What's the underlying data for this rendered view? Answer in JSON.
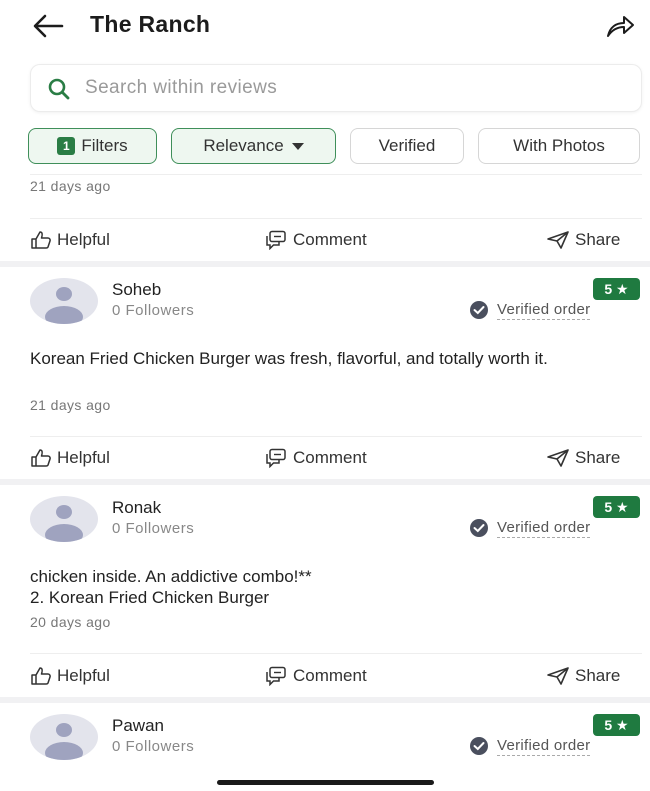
{
  "header": {
    "title": "The Ranch",
    "back_icon": "arrow-left-icon",
    "share_icon": "share-forward-icon"
  },
  "search": {
    "placeholder": "Search within reviews",
    "icon": "search-icon",
    "accent": "#2a7d45"
  },
  "filters": {
    "filters_count": "1",
    "filters_label": "Filters",
    "relevance_label": "Relevance",
    "verified_label": "Verified",
    "with_photos_label": "With Photos"
  },
  "top_review": {
    "time": "21 days ago"
  },
  "actions": {
    "helpful": "Helpful",
    "comment": "Comment",
    "share": "Share"
  },
  "reviews": [
    {
      "name": "Soheb",
      "followers": "0 Followers",
      "rating": "5 ★",
      "verified": "Verified order",
      "body": "Korean Fried Chicken Burger was fresh, flavorful, and totally worth it.",
      "time": "21 days ago"
    },
    {
      "name": "Ronak",
      "followers": "0 Followers",
      "rating": "5 ★",
      "verified": "Verified order",
      "body_line1": "chicken inside. An addictive combo!**",
      "body_line2": "2. Korean Fried Chicken Burger",
      "time": "20 days ago"
    },
    {
      "name": "Pawan",
      "followers": "0 Followers",
      "rating": "5 ★",
      "verified": "Verified order"
    }
  ],
  "colors": {
    "rating_badge": "#1f7a40",
    "filter_active": "#3f8f5a"
  }
}
